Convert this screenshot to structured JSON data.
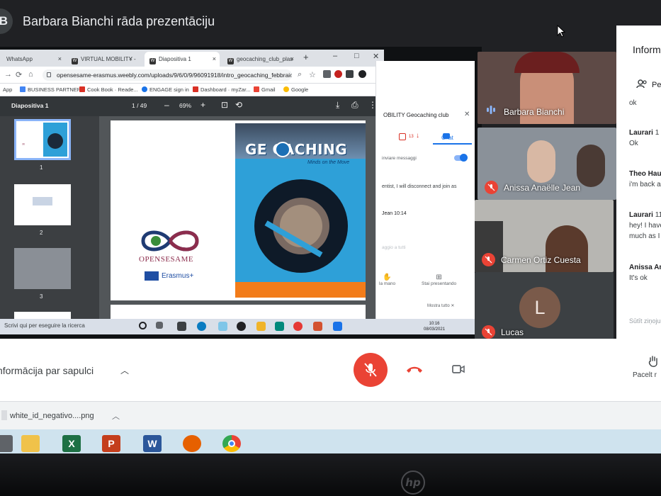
{
  "meet": {
    "presenter_initial": "B",
    "presenting_title": "Barbara Bianchi rāda prezentāciju",
    "side_panel_title": "Inform",
    "people_label": "Pe",
    "meeting_info": "nformācija par sapulci",
    "raise_hand": "Pacelt r",
    "send_placeholder": "Sūtīt ziņoju",
    "participants": [
      {
        "name": "Barbara Bianchi"
      },
      {
        "name": "Anissa Anaëlle Jean"
      },
      {
        "name": "Carmen Ortiz Cuesta"
      },
      {
        "name": "Lucas",
        "initial": "L"
      }
    ],
    "messages": [
      {
        "sender": "",
        "text": "ok"
      },
      {
        "sender": "Laurari",
        "extra": "1",
        "text": "Ok"
      },
      {
        "sender": "Theo Hau",
        "extra": "",
        "text": "i'm back a"
      },
      {
        "sender": "Laurari",
        "extra": "11",
        "text": "hey! I have",
        "text2": "much as I"
      },
      {
        "sender": "Anissa Ana",
        "extra": "",
        "text": "It's ok"
      }
    ]
  },
  "browser": {
    "tabs": [
      "WhatsApp",
      "VIRTUAL MOBILITY - O",
      "Diapositiva 1",
      "geocaching_club_plas"
    ],
    "url": "opensesame-erasmus.weebly.com/uploads/9/6/0/9/96091918/intro_geocaching_febbraio_2",
    "bookmarks": [
      "App",
      "BUSINESS PARTNER...",
      "Cook Book · Reade...",
      "ENGAGE sign in",
      "Dashboard · myZar...",
      "Gmail",
      "Google"
    ],
    "bookmarks2": [
      "k · Reade...",
      "ENGAGE sign in"
    ]
  },
  "pdf": {
    "title": "Diapositiva 1",
    "page": "1 / 49",
    "zoom": "69%",
    "thumb_numbers": [
      "1",
      "2",
      "3"
    ],
    "logo_text": "OPENSESAME",
    "erasmus_text": "Erasmus+",
    "poster_title": "GE  CACHING",
    "poster_subtitle": "Minds on the Move"
  },
  "shared_chat": {
    "header": "OBILITY Geocaching club",
    "tab": "Chat",
    "counter": "13",
    "toggle_label": "inviare messaggi",
    "message": "entist, I will disconnect and join as",
    "sender": "Jean 10:14",
    "placeholder": "aggio a tutti",
    "foot1": "la mano",
    "foot2": "Stai presentando",
    "more": "Mostra tutto"
  },
  "windows": {
    "search": "Scrivi qui per eseguire la ricerca",
    "time": "10:16",
    "date": "08/03/2021"
  },
  "download": {
    "filename": "white_id_negativo....png"
  },
  "colors": {
    "meet_bg": "#202124",
    "mic_off": "#ea4335",
    "accent": "#1a73e8",
    "logo": "#8c2d4d"
  }
}
